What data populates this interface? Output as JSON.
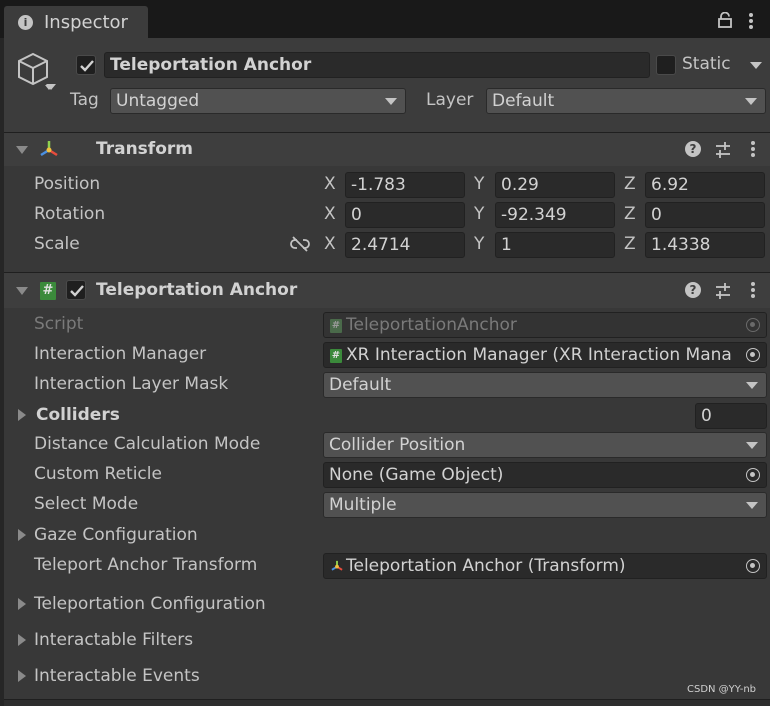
{
  "tab": {
    "title": "Inspector"
  },
  "header": {
    "object_name": "Teleportation Anchor",
    "static_label": "Static",
    "tag_label": "Tag",
    "tag_value": "Untagged",
    "layer_label": "Layer",
    "layer_value": "Default"
  },
  "transform": {
    "title": "Transform",
    "rows": [
      {
        "label": "Position",
        "x": "-1.783",
        "y": "0.29",
        "z": "6.92"
      },
      {
        "label": "Rotation",
        "x": "0",
        "y": "-92.349",
        "z": "0"
      },
      {
        "label": "Scale",
        "x": "2.4714",
        "y": "1",
        "z": "1.4338"
      }
    ],
    "axis_x": "X",
    "axis_y": "Y",
    "axis_z": "Z"
  },
  "component": {
    "title": "Teleportation Anchor",
    "script_label": "Script",
    "script_value": "TeleportationAnchor",
    "interaction_manager_label": "Interaction Manager",
    "interaction_manager_value": "XR Interaction Manager (XR Interaction Mana",
    "layer_mask_label": "Interaction Layer Mask",
    "layer_mask_value": "Default",
    "colliders_label": "Colliders",
    "colliders_count": "0",
    "distance_mode_label": "Distance Calculation Mode",
    "distance_mode_value": "Collider Position",
    "custom_reticle_label": "Custom Reticle",
    "custom_reticle_value": "None (Game Object)",
    "select_mode_label": "Select Mode",
    "select_mode_value": "Multiple",
    "gaze_label": "Gaze Configuration",
    "anchor_transform_label": "Teleport Anchor Transform",
    "anchor_transform_value": "Teleportation Anchor (Transform)",
    "teleport_config_label": "Teleportation Configuration",
    "filters_label": "Interactable Filters",
    "events_label": "Interactable Events"
  },
  "watermark": "CSDN @YY-nb"
}
